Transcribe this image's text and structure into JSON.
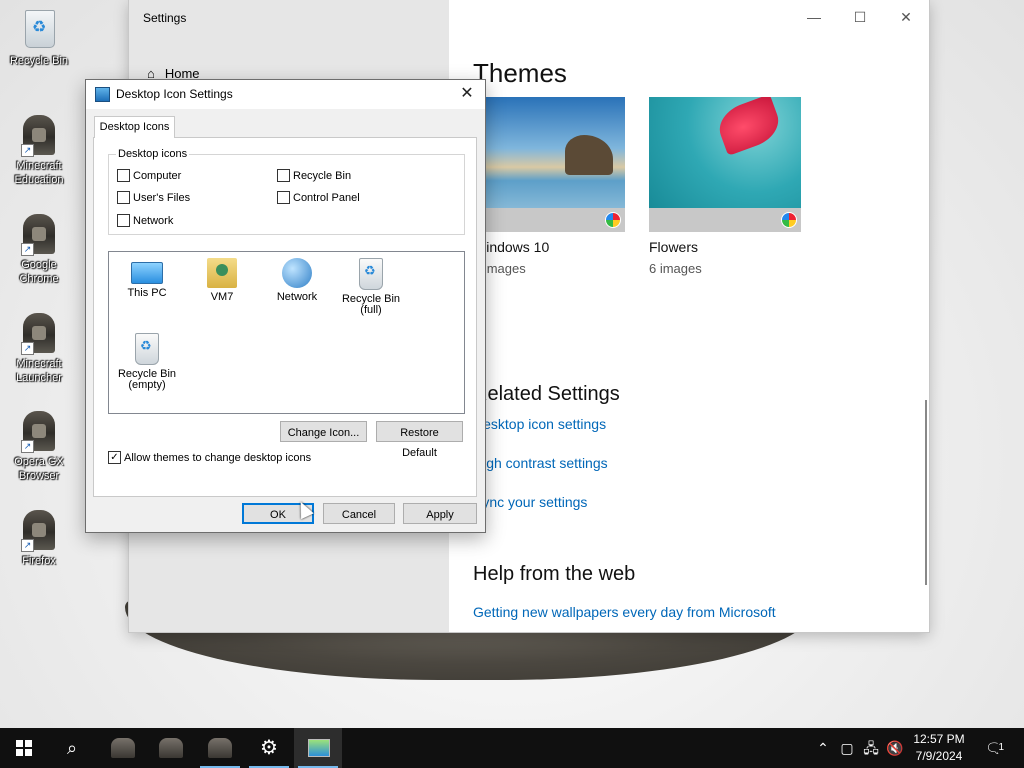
{
  "desktop": {
    "icons": [
      {
        "label": "Recycle Bin"
      },
      {
        "label": "Minecraft Education"
      },
      {
        "label": "Google Chrome"
      },
      {
        "label": "Minecraft Launcher"
      },
      {
        "label": "Opera GX Browser"
      },
      {
        "label": "Firefox"
      }
    ]
  },
  "settings": {
    "title": "Settings",
    "home_label": "Home",
    "themes_heading": "Themes",
    "themes": [
      {
        "name": "Windows 10",
        "count": "5 images"
      },
      {
        "name": "Flowers",
        "count": "6 images"
      }
    ],
    "related_heading": "Related Settings",
    "related_links": [
      "Desktop icon settings",
      "High contrast settings",
      "Sync your settings"
    ],
    "help_heading": "Help from the web",
    "help_links": [
      "Getting new wallpapers every day from Microsoft"
    ]
  },
  "dialog": {
    "title": "Desktop Icon Settings",
    "tab_label": "Desktop Icons",
    "group_label": "Desktop icons",
    "checkboxes": [
      {
        "label": "Computer",
        "checked": false
      },
      {
        "label": "Recycle Bin",
        "checked": false
      },
      {
        "label": "User's Files",
        "checked": false
      },
      {
        "label": "Control Panel",
        "checked": false
      },
      {
        "label": "Network",
        "checked": false
      }
    ],
    "icon_items": [
      {
        "label": "This PC"
      },
      {
        "label": "VM7"
      },
      {
        "label": "Network"
      },
      {
        "label": "Recycle Bin (full)"
      },
      {
        "label": "Recycle Bin (empty)"
      }
    ],
    "change_icon_label": "Change Icon...",
    "restore_default_label": "Restore Default",
    "allow_themes_label": "Allow themes to change desktop icons",
    "allow_themes_checked": true,
    "ok_label": "OK",
    "cancel_label": "Cancel",
    "apply_label": "Apply"
  },
  "taskbar": {
    "time": "12:57 PM",
    "date": "7/9/2024",
    "notification_count": "1"
  }
}
